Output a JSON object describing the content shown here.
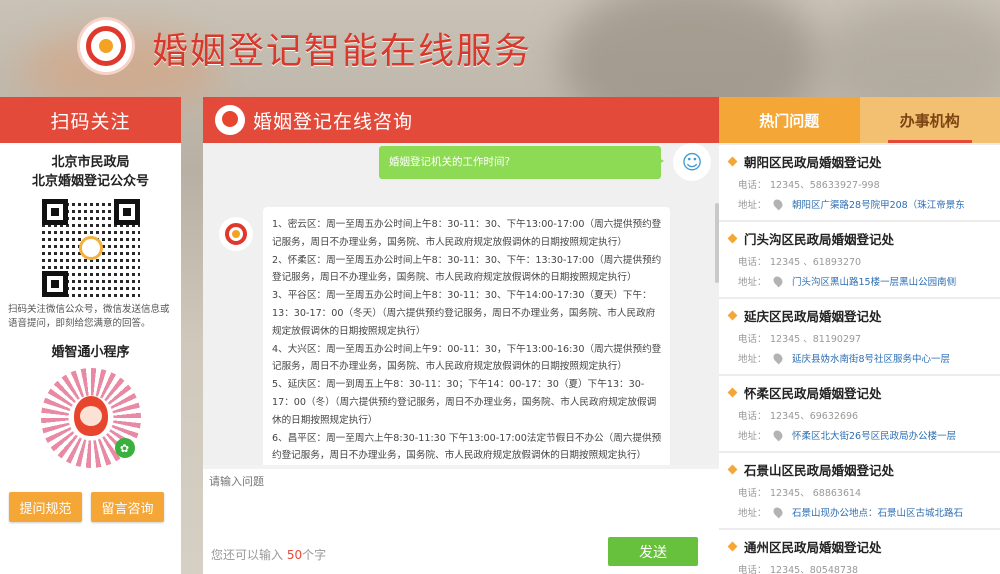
{
  "header": {
    "title": "婚姻登记智能在线服务"
  },
  "left": {
    "title": "扫码关注",
    "account_line1": "北京市民政局",
    "account_line2": "北京婚姻登记公众号",
    "scan_tip": "扫码关注微信公众号，微信发送信息或语音提问，即刻给您满意的回答。",
    "mini_title": "婚智通小程序",
    "btn_rules": "提问规范",
    "btn_message": "留言咨询"
  },
  "center": {
    "title": "婚姻登记在线咨询",
    "user_question": "婚姻登记机关的工作时间?",
    "bot_answer": [
      "1、密云区：周一至周五办公时间上午8：30-11：30、下午13:00-17:00（周六提供预约登记服务，周日不办理业务，国务院、市人民政府规定放假调休的日期按照规定执行）",
      "2、怀柔区：周一至周五办公时间上午8：30-11：30、下午：13:30-17:00（周六提供预约登记服务，周日不办理业务，国务院、市人民政府规定放假调休的日期按照规定执行）",
      "3、平谷区：周一至周五办公时间上午8：30-11：30、下午14:00-17:30（夏天）下午：13：30-17：00（冬天）（周六提供预约登记服务，周日不办理业务，国务院、市人民政府规定放假调休的日期按照规定执行）",
      "4、大兴区：周一至周五办公时间上午9：00-11：30，下午13:00-16:30（周六提供预约登记服务，周日不办理业务，国务院、市人民政府规定放假调休的日期按照规定执行）",
      "5、延庆区：周一到周五上午8：30-11：30；下午14：00-17：30（夏）下午13：30-17：00（冬）（周六提供预约登记服务，周日不办理业务，国务院、市人民政府规定放假调休的日期按照规定执行）",
      "6、昌平区：周一至周六上午8:30-11:30 下午13:00-17:00法定节假日不办公（周六提供预约登记服务，周日不办理业务，国务院、市人民政府规定放假调休的日期按照规定执行）"
    ],
    "input_placeholder": "请输入问题",
    "count_prefix": "您还可以输入",
    "count_value": "50",
    "count_suffix": "个字",
    "send_label": "发送"
  },
  "right": {
    "tab_hot": "热门问题",
    "tab_org": "办事机构",
    "phone_label": "电话：",
    "addr_label": "地址：",
    "orgs": [
      {
        "name": "朝阳区民政局婚姻登记处",
        "phone": "12345、58633927-998",
        "addr": "朝阳区广渠路28号院甲208（珠江帝景东"
      },
      {
        "name": "门头沟区民政局婚姻登记处",
        "phone": "12345 、61893270",
        "addr": "门头沟区黑山路15楼一层黑山公园南侧"
      },
      {
        "name": "延庆区民政局婚姻登记处",
        "phone": "12345 、81190297",
        "addr": "延庆县妫水南街8号社区服务中心一层"
      },
      {
        "name": "怀柔区民政局婚姻登记处",
        "phone": "12345、69632696",
        "addr": "怀柔区北大街26号区民政局办公楼一层"
      },
      {
        "name": "石景山区民政局婚姻登记处",
        "phone": "12345、 68863614",
        "addr": "石景山现办公地点：石景山区古城北路石"
      },
      {
        "name": "通州区民政局婚姻登记处",
        "phone": "12345、80548738",
        "addr": ""
      }
    ]
  },
  "colors": {
    "accent_red": "#e34a3a",
    "accent_orange": "#f4a636",
    "send_green": "#68c13c",
    "user_bubble": "#8ddb55"
  }
}
